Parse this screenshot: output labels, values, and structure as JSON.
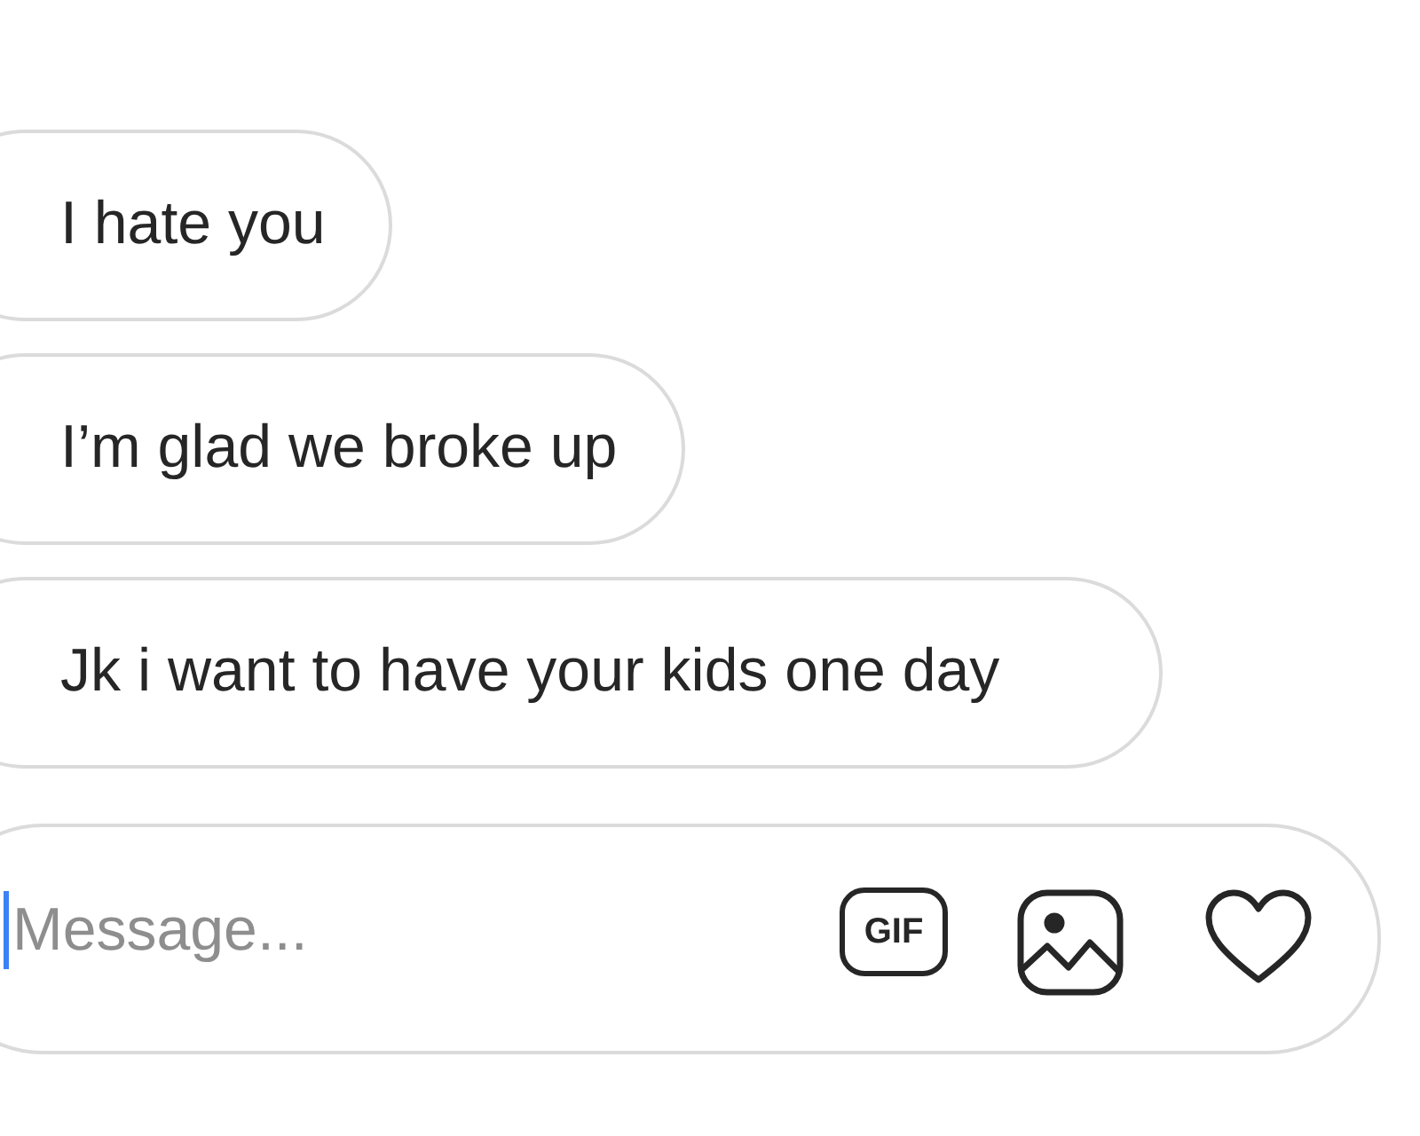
{
  "messages": [
    {
      "text": "I hate you"
    },
    {
      "text": "I’m glad we broke up"
    },
    {
      "text": "Jk i want to have your kids one day"
    }
  ],
  "composer": {
    "placeholder": "Message...",
    "gif_label": "GIF"
  }
}
